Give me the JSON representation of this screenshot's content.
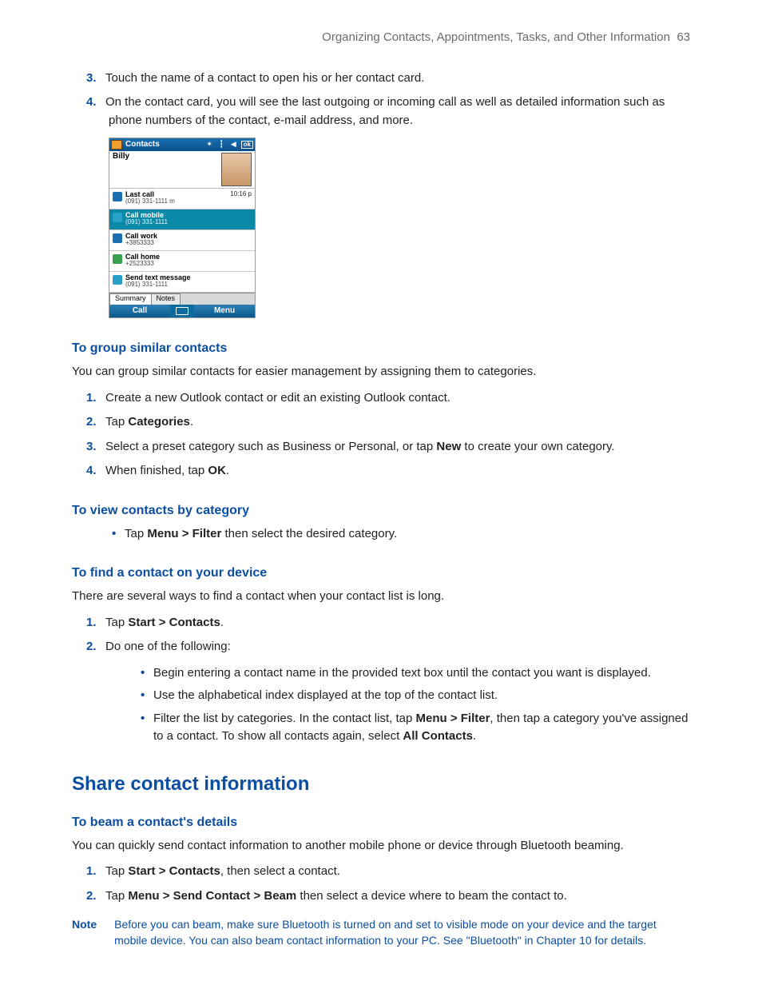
{
  "header": {
    "chapter": "Organizing Contacts, Appointments, Tasks, and Other Information",
    "page": "63"
  },
  "intro_steps": [
    {
      "n": "3.",
      "text": "Touch the name of a contact to open his or her contact card."
    },
    {
      "n": "4.",
      "text": "On the contact card, you will see the last outgoing or incoming call as well as detailed information such as phone numbers of the contact, e-mail address, and more."
    }
  ],
  "device": {
    "title": "Contacts",
    "ok": "ok",
    "name": "Billy",
    "rows": [
      {
        "icon": "ic-blue",
        "title": "Last call",
        "sub": "(091) 331-1111 m",
        "time": "10:16 p",
        "sel": false
      },
      {
        "icon": "ic-cyan",
        "title": "Call mobile",
        "sub": "(091) 331-1111",
        "time": "",
        "sel": true
      },
      {
        "icon": "ic-blue",
        "title": "Call work",
        "sub": "+3853333",
        "time": "",
        "sel": false
      },
      {
        "icon": "ic-grn",
        "title": "Call home",
        "sub": "+2523333",
        "time": "",
        "sel": false
      },
      {
        "icon": "ic-cyan",
        "title": "Send text message",
        "sub": "(091) 331-1111",
        "time": "",
        "sel": false
      }
    ],
    "tabs": [
      "Summary",
      "Notes"
    ],
    "softleft": "Call",
    "softright": "Menu"
  },
  "group": {
    "heading": "To group similar contacts",
    "para": "You can group similar contacts for easier management by assigning them to categories.",
    "steps": [
      {
        "n": "1.",
        "parts": [
          "Create a new Outlook contact or edit an existing Outlook contact."
        ]
      },
      {
        "n": "2.",
        "parts": [
          "Tap ",
          [
            "b",
            "Categories"
          ],
          "."
        ]
      },
      {
        "n": "3.",
        "parts": [
          "Select a preset category such as Business or Personal, or tap ",
          [
            "b",
            "New"
          ],
          " to create your own category."
        ]
      },
      {
        "n": "4.",
        "parts": [
          "When finished, tap ",
          [
            "b",
            "OK"
          ],
          "."
        ]
      }
    ]
  },
  "viewcat": {
    "heading": "To view contacts by category",
    "bullet": {
      "parts": [
        "Tap ",
        [
          "b",
          "Menu > Filter"
        ],
        " then select the desired category."
      ]
    }
  },
  "find": {
    "heading": "To find a contact on your device",
    "para": "There are several ways to find a contact when your contact list is long.",
    "steps": [
      {
        "n": "1.",
        "parts": [
          "Tap ",
          [
            "b",
            "Start > Contacts"
          ],
          "."
        ]
      },
      {
        "n": "2.",
        "parts": [
          "Do one of the following:"
        ]
      }
    ],
    "sub_bullets": [
      {
        "parts": [
          "Begin entering a contact name in the provided text box until the contact you want is displayed."
        ]
      },
      {
        "parts": [
          "Use the alphabetical index displayed at the top of the contact list."
        ]
      },
      {
        "parts": [
          "Filter the list by categories. In the contact list, tap ",
          [
            "b",
            "Menu > Filter"
          ],
          ", then tap a category you've assigned to a contact. To show all contacts again, select ",
          [
            "b",
            "All Contacts"
          ],
          "."
        ]
      }
    ]
  },
  "share": {
    "heading": "Share contact information",
    "beam_heading": "To beam a contact's details",
    "para": "You can quickly send contact information to another mobile phone or device through Bluetooth beaming.",
    "steps": [
      {
        "n": "1.",
        "parts": [
          "Tap ",
          [
            "b",
            "Start > Contacts"
          ],
          ", then select a contact."
        ]
      },
      {
        "n": "2.",
        "parts": [
          "Tap ",
          [
            "b",
            "Menu > Send Contact > Beam"
          ],
          " then select a device where to beam the contact to."
        ]
      }
    ],
    "note_label": "Note",
    "note_text": "Before you can beam, make sure Bluetooth is turned on and set to visible mode on your device and the target mobile device. You can also beam contact information to your PC. See \"Bluetooth\" in Chapter 10 for details."
  }
}
